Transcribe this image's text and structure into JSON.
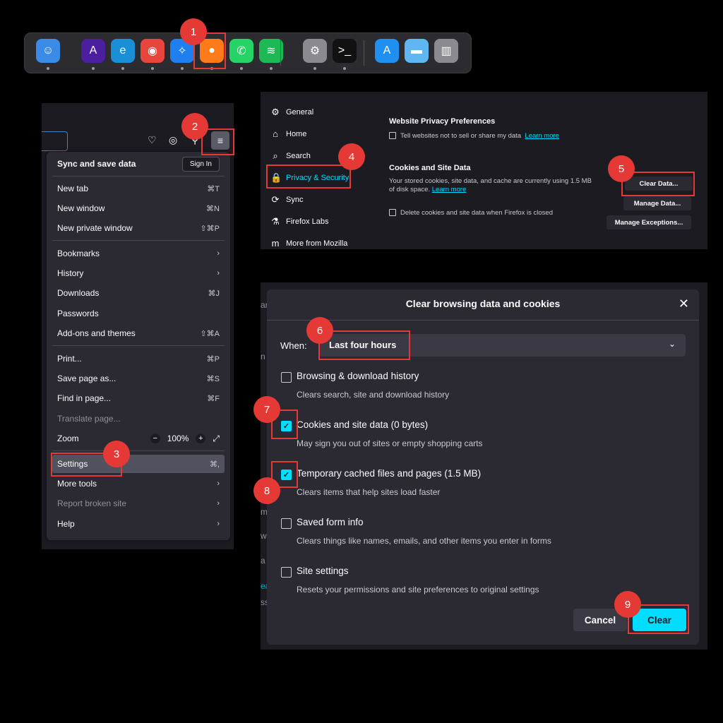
{
  "steps": [
    "1",
    "2",
    "3",
    "4",
    "5",
    "6",
    "7",
    "8",
    "9"
  ],
  "dock": {
    "apps": [
      {
        "name": "finder-icon",
        "glyph": "☺",
        "color": "#3a8be6"
      },
      {
        "name": "arc-icon",
        "glyph": "A",
        "color": "#4b1fa0"
      },
      {
        "name": "edge-icon",
        "glyph": "e",
        "color": "#1a8fd6"
      },
      {
        "name": "chrome-icon",
        "glyph": "◉",
        "color": "#e8453c"
      },
      {
        "name": "safari-icon",
        "glyph": "✧",
        "color": "#1f7ef0"
      },
      {
        "name": "firefox-icon",
        "glyph": "●",
        "color": "#ff7a18"
      },
      {
        "name": "whatsapp-icon",
        "glyph": "✆",
        "color": "#25d366"
      },
      {
        "name": "spotify-icon",
        "glyph": "≋",
        "color": "#1db954"
      },
      {
        "name": "system-settings-icon",
        "glyph": "⚙",
        "color": "#8a8a90"
      },
      {
        "name": "terminal-icon",
        "glyph": ">_",
        "color": "#111"
      },
      {
        "name": "app-store-icon",
        "glyph": "A",
        "color": "#1f8ff0"
      },
      {
        "name": "folder-icon",
        "glyph": "▬",
        "color": "#5fb6f0"
      },
      {
        "name": "trash-icon",
        "glyph": "▥",
        "color": "#8a8a90"
      }
    ]
  },
  "menu": {
    "sync_label": "Sync and save data",
    "sign_in": "Sign In",
    "items": [
      {
        "label": "New tab",
        "shortcut": "⌘T"
      },
      {
        "label": "New window",
        "shortcut": "⌘N"
      },
      {
        "label": "New private window",
        "shortcut": "⇧⌘P"
      },
      {
        "label": "Bookmarks",
        "shortcut": "›"
      },
      {
        "label": "History",
        "shortcut": "›"
      },
      {
        "label": "Downloads",
        "shortcut": "⌘J"
      },
      {
        "label": "Passwords",
        "shortcut": ""
      },
      {
        "label": "Add-ons and themes",
        "shortcut": "⇧⌘A"
      },
      {
        "label": "Print...",
        "shortcut": "⌘P"
      },
      {
        "label": "Save page as...",
        "shortcut": "⌘S"
      },
      {
        "label": "Find in page...",
        "shortcut": "⌘F"
      },
      {
        "label": "Translate page...",
        "shortcut": ""
      },
      {
        "label": "Zoom",
        "shortcut": ""
      },
      {
        "label": "Settings",
        "shortcut": "⌘,"
      },
      {
        "label": "More tools",
        "shortcut": "›"
      },
      {
        "label": "Report broken site",
        "shortcut": "›"
      },
      {
        "label": "Help",
        "shortcut": "›"
      }
    ],
    "zoom_level": "100%"
  },
  "settings": {
    "nav": [
      {
        "label": "General",
        "icon": "gear-icon",
        "glyph": "⚙"
      },
      {
        "label": "Home",
        "icon": "home-icon",
        "glyph": "⌂"
      },
      {
        "label": "Search",
        "icon": "search-icon",
        "glyph": "⌕"
      },
      {
        "label": "Privacy & Security",
        "icon": "lock-icon",
        "glyph": "🔒"
      },
      {
        "label": "Sync",
        "icon": "sync-icon",
        "glyph": "⟳"
      },
      {
        "label": "Firefox Labs",
        "icon": "labs-icon",
        "glyph": "⚗"
      },
      {
        "label": "More from Mozilla",
        "icon": "mozilla-icon",
        "glyph": "m"
      }
    ],
    "privacy_heading": "Website Privacy Preferences",
    "privacy_opt": "Tell websites not to sell or share my data",
    "learn_more": "Learn more",
    "cookies_heading": "Cookies and Site Data",
    "cookies_desc_1": "Your stored cookies, site data, and cache are currently using 1.5 MB",
    "cookies_desc_2": "of disk space.",
    "delete_opt": "Delete cookies and site data when Firefox is closed",
    "btn_clear": "Clear Data...",
    "btn_manage": "Manage Data...",
    "btn_exceptions": "Manage Exceptions..."
  },
  "dialog": {
    "title": "Clear browsing data and cookies",
    "when_label": "When:",
    "when_value": "Last four hours",
    "options": [
      {
        "label": "Browsing & download history",
        "desc": "Clears search, site and download history",
        "checked": false
      },
      {
        "label": "Cookies and site data (0 bytes)",
        "desc": "May sign you out of sites or empty shopping carts",
        "checked": true
      },
      {
        "label": "Temporary cached files and pages (1.5 MB)",
        "desc": "Clears items that help sites load faster",
        "checked": true
      },
      {
        "label": "Saved form info",
        "desc": "Clears things like names, emails, and other items you enter in forms",
        "checked": false
      },
      {
        "label": "Site settings",
        "desc": "Resets your permissions and site preferences to original settings",
        "checked": false
      }
    ],
    "cancel": "Cancel",
    "clear": "Clear"
  },
  "colors": {
    "accent": "#00ddff",
    "marker": "#e53935"
  }
}
